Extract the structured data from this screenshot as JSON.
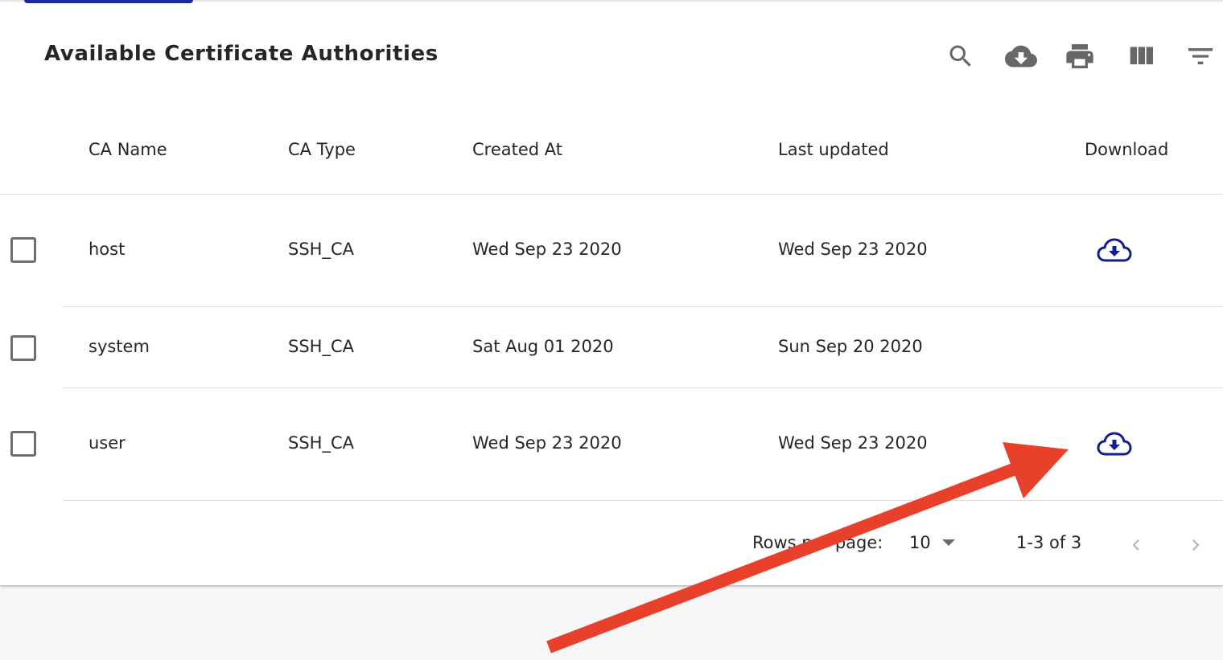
{
  "table": {
    "title": "Available Certificate Authorities",
    "toolbar_icons": [
      "search-icon",
      "cloud-download-icon",
      "print-icon",
      "view-columns-icon",
      "filter-icon"
    ],
    "columns": {
      "name": "CA Name",
      "type": "CA Type",
      "created": "Created At",
      "updated": "Last updated",
      "download": "Download"
    },
    "rows": [
      {
        "name": "host",
        "type": "SSH_CA",
        "created": "Wed Sep 23 2020",
        "updated": "Wed Sep 23 2020",
        "download_icon": "cloud-download-icon"
      },
      {
        "name": "system",
        "type": "SSH_CA",
        "created": "Sat Aug 01 2020",
        "updated": "Sun Sep 20 2020",
        "download_icon": ""
      },
      {
        "name": "user",
        "type": "SSH_CA",
        "created": "Wed Sep 23 2020",
        "updated": "Wed Sep 23 2020",
        "download_icon": "cloud-download-icon"
      }
    ],
    "footer": {
      "rows_per_page_label": "Rows per page:",
      "rows_per_page_value": "10",
      "range": "1-3 of 3"
    }
  },
  "colors": {
    "accent": "#1c2a9c",
    "download_icon": "#0f1e8c",
    "annotation_arrow": "#e8412b",
    "icon_gray": "#676767"
  }
}
